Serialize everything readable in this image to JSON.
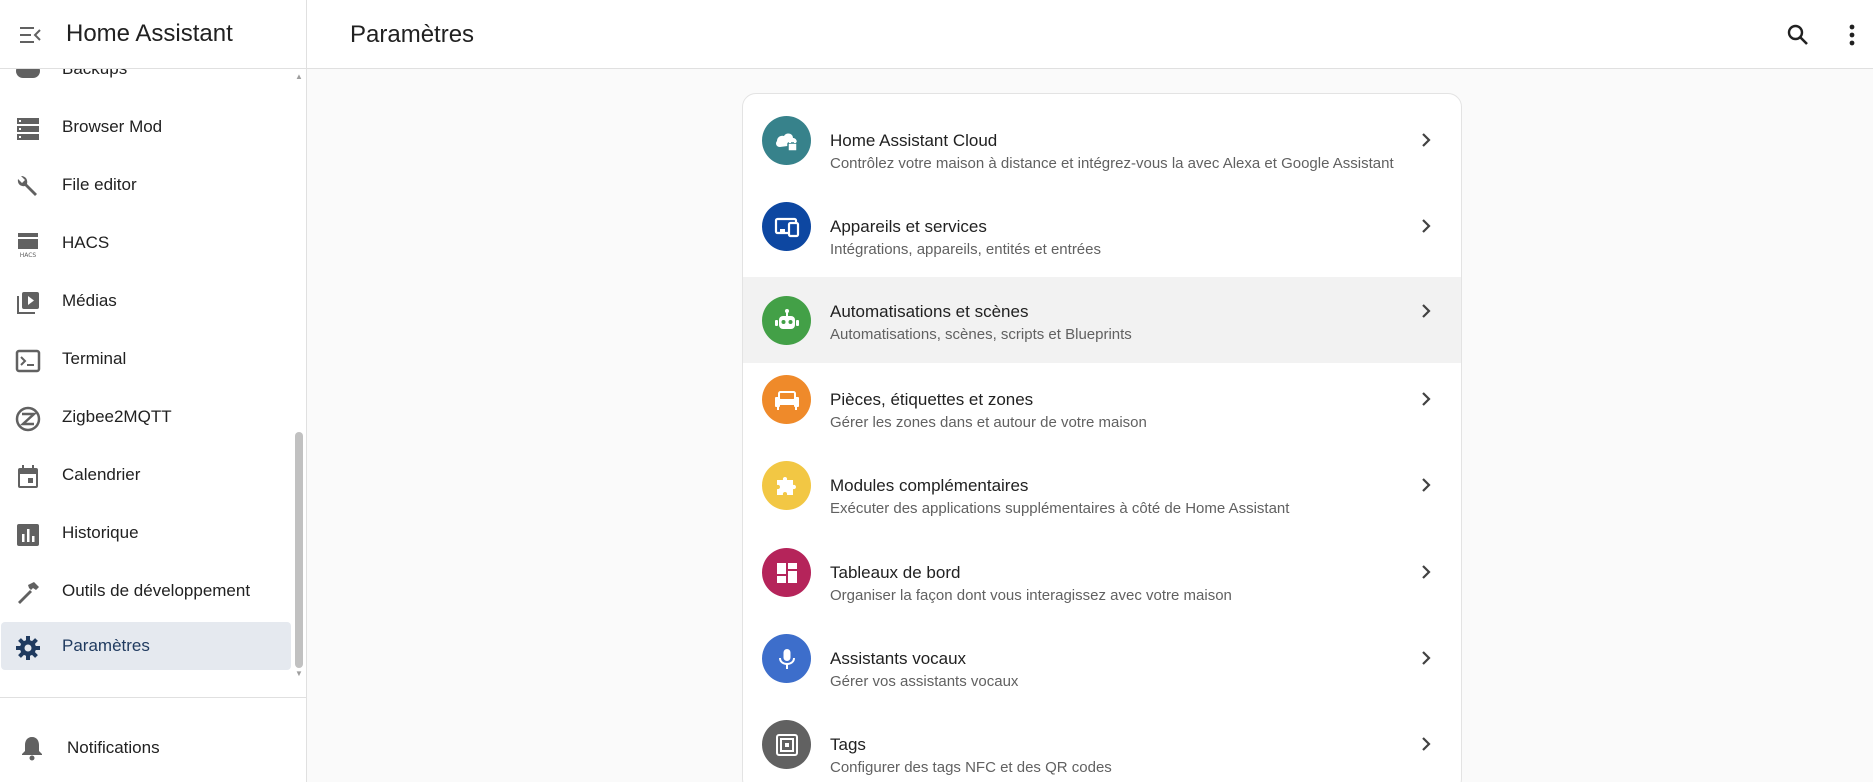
{
  "sidebar": {
    "title": "Home Assistant",
    "items": [
      {
        "label": "Backups",
        "icon": "backup-icon"
      },
      {
        "label": "Browser Mod",
        "icon": "server-icon"
      },
      {
        "label": "File editor",
        "icon": "wrench-icon"
      },
      {
        "label": "HACS",
        "icon": "hacs-icon"
      },
      {
        "label": "Médias",
        "icon": "media-icon"
      },
      {
        "label": "Terminal",
        "icon": "terminal-icon"
      },
      {
        "label": "Zigbee2MQTT",
        "icon": "zigbee-icon"
      },
      {
        "label": "Calendrier",
        "icon": "calendar-icon"
      },
      {
        "label": "Historique",
        "icon": "history-chart-icon"
      },
      {
        "label": "Outils de développement",
        "icon": "hammer-icon"
      },
      {
        "label": "Paramètres",
        "icon": "gear-icon",
        "active": true
      }
    ],
    "notifications_label": "Notifications",
    "hacs_icon_text": "HACS"
  },
  "header": {
    "title": "Paramètres"
  },
  "settings": [
    {
      "title": "Home Assistant Cloud",
      "desc": "Contrôlez votre maison à distance et intégrez-vous la avec Alexa et Google Assistant",
      "color": "#37828b",
      "icon": "cloud-lock-icon"
    },
    {
      "title": "Appareils et services",
      "desc": "Intégrations, appareils, entités et entrées",
      "color": "#0d47a1",
      "icon": "devices-icon"
    },
    {
      "title": "Automatisations et scènes",
      "desc": "Automatisations, scènes, scripts et Blueprints",
      "color": "#43a047",
      "icon": "robot-icon"
    },
    {
      "title": "Pièces, étiquettes et zones",
      "desc": "Gérer les zones dans et autour de votre maison",
      "color": "#ef8a2a",
      "icon": "sofa-icon"
    },
    {
      "title": "Modules complémentaires",
      "desc": "Exécuter des applications supplémentaires à côté de Home Assistant",
      "color": "#f2c744",
      "icon": "puzzle-icon"
    },
    {
      "title": "Tableaux de bord",
      "desc": "Organiser la façon dont vous interagissez avec votre maison",
      "color": "#b5245a",
      "icon": "dashboard-icon"
    },
    {
      "title": "Assistants vocaux",
      "desc": "Gérer vos assistants vocaux",
      "color": "#3d6ecb",
      "icon": "microphone-icon"
    },
    {
      "title": "Tags",
      "desc": "Configurer des tags NFC et des QR codes",
      "color": "#616161",
      "icon": "nfc-tag-icon"
    }
  ]
}
